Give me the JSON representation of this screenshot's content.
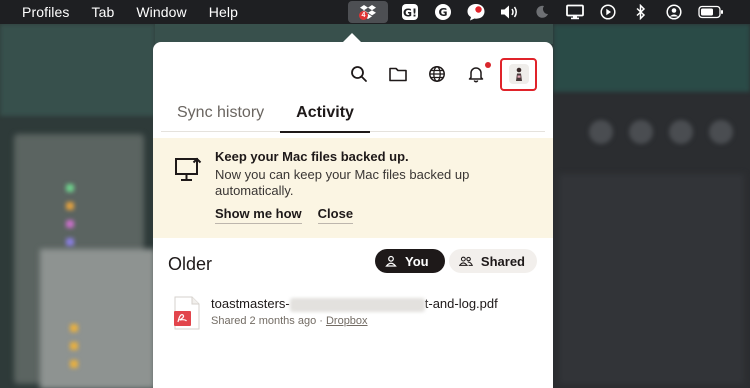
{
  "menubar": {
    "items": [
      "Profiles",
      "Tab",
      "Window",
      "Help"
    ],
    "dropbox_badge": "4",
    "status_icons": [
      "dropbox-icon",
      "grammarly-go-icon",
      "grammarly-icon",
      "chat-icon",
      "volume-icon",
      "moon-icon",
      "display-icon",
      "play-icon",
      "bluetooth-icon",
      "user-icon",
      "battery-icon"
    ]
  },
  "toolbar": {
    "icons": [
      "search-icon",
      "folder-icon",
      "globe-icon",
      "bell-icon",
      "avatar"
    ],
    "accent": "#e0232a"
  },
  "tabs": [
    {
      "label": "Sync history",
      "active": false
    },
    {
      "label": "Activity",
      "active": true
    }
  ],
  "banner": {
    "title": "Keep your Mac files backed up.",
    "text": "Now you can keep your Mac files backed up automatically.",
    "primary_link": "Show me how",
    "secondary_link": "Close",
    "bg_color": "#fbf5e3"
  },
  "section": {
    "title": "Older",
    "filter_you": "You",
    "filter_shared": "Shared"
  },
  "file": {
    "name_start": "toastmasters-",
    "name_end": "t-and-log.pdf",
    "meta": "Shared 2 months ago",
    "separator": " · ",
    "location": "Dropbox",
    "icon_color": "#e2454c"
  }
}
